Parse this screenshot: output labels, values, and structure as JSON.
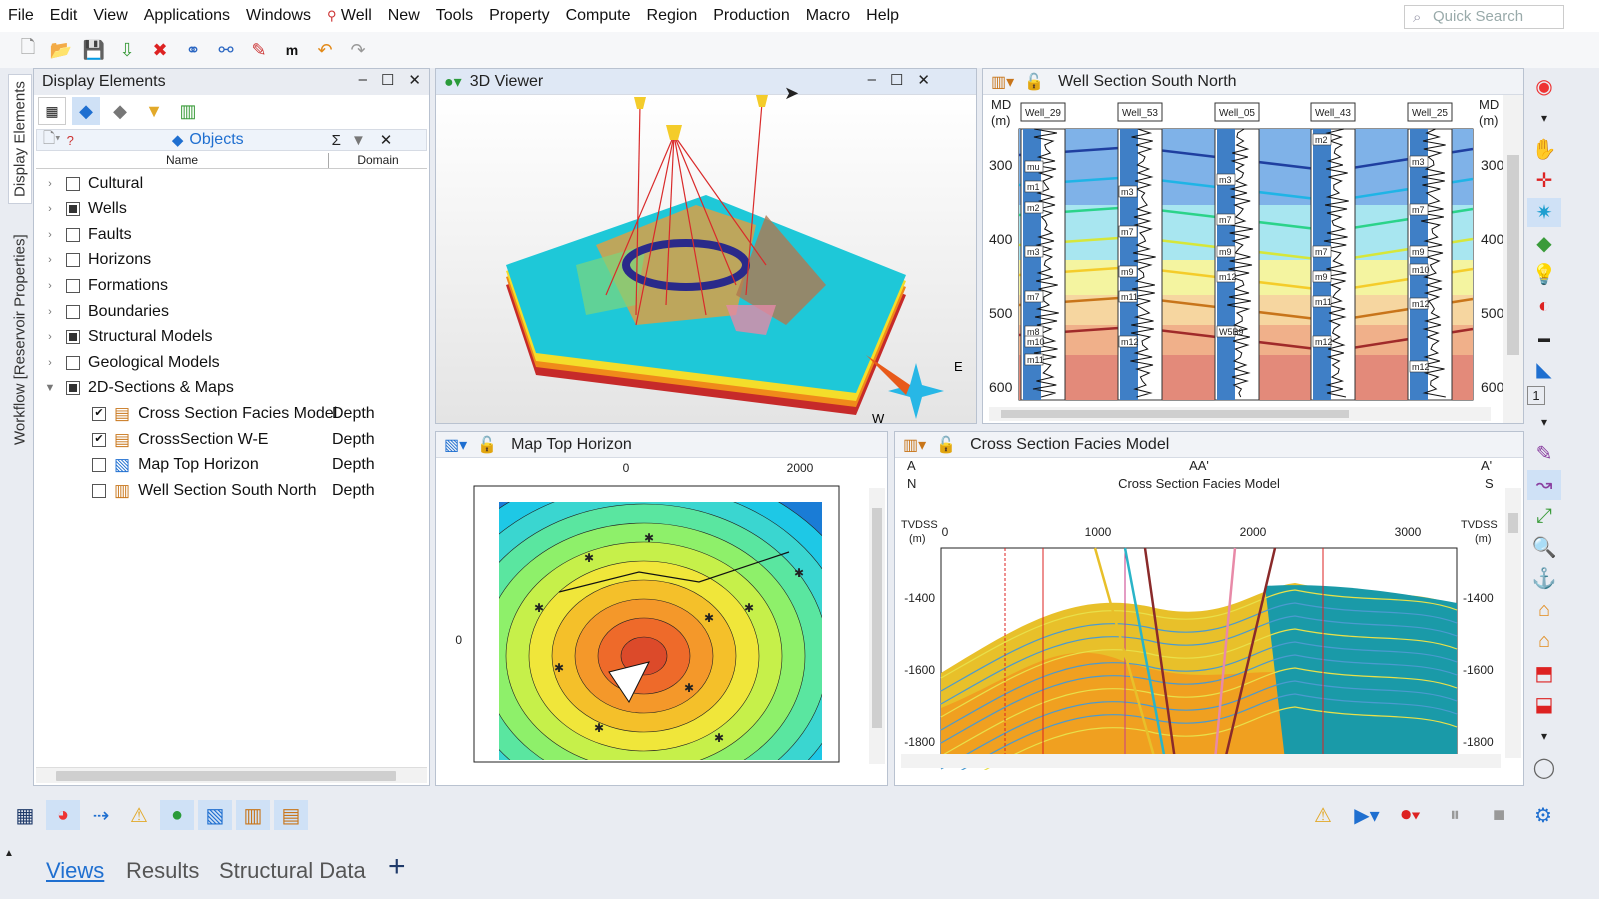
{
  "menu": {
    "items": [
      "File",
      "Edit",
      "View",
      "Applications",
      "Windows",
      "Well",
      "New",
      "Tools",
      "Property",
      "Compute",
      "Region",
      "Production",
      "Macro",
      "Help"
    ],
    "search_placeholder": "Quick Search"
  },
  "side_tabs": {
    "display": "Display Elements",
    "workflow": "Workflow [Reservoir Properties]"
  },
  "display_panel": {
    "title": "Display Elements",
    "objects_label": "Objects",
    "col_name": "Name",
    "col_domain": "Domain"
  },
  "tree": [
    {
      "label": "Cultural",
      "state": "unchecked",
      "level": 0,
      "expander": "collapsed"
    },
    {
      "label": "Wells",
      "state": "partial",
      "level": 0,
      "expander": "collapsed"
    },
    {
      "label": "Faults",
      "state": "unchecked",
      "level": 0,
      "expander": "collapsed"
    },
    {
      "label": "Horizons",
      "state": "unchecked",
      "level": 0,
      "expander": "collapsed"
    },
    {
      "label": "Formations",
      "state": "unchecked",
      "level": 0,
      "expander": "collapsed"
    },
    {
      "label": "Boundaries",
      "state": "unchecked",
      "level": 0,
      "expander": "collapsed"
    },
    {
      "label": "Structural Models",
      "state": "partial",
      "level": 0,
      "expander": "collapsed"
    },
    {
      "label": "Geological Models",
      "state": "unchecked",
      "level": 0,
      "expander": "collapsed"
    },
    {
      "label": "2D-Sections & Maps",
      "state": "partial",
      "level": 0,
      "expander": "expanded"
    },
    {
      "label": "Cross Section Facies Model",
      "domain": "Depth",
      "state": "checked",
      "level": 1,
      "icon": "section-icon"
    },
    {
      "label": "CrossSection W-E",
      "domain": "Depth",
      "state": "checked",
      "level": 1,
      "icon": "section-icon"
    },
    {
      "label": "Map Top Horizon",
      "domain": "Depth",
      "state": "unchecked",
      "level": 1,
      "icon": "map-icon"
    },
    {
      "label": "Well Section South North",
      "domain": "Depth",
      "state": "unchecked",
      "level": 1,
      "icon": "well-section-icon"
    }
  ],
  "viewer3d": {
    "title": "3D Viewer",
    "compass_e": "E",
    "compass_w": "W"
  },
  "well_section": {
    "title": "Well Section South North",
    "md_label": "MD",
    "unit": "(m)",
    "depths": [
      "300",
      "400",
      "500",
      "600"
    ],
    "wells": [
      "Well_29",
      "Well_53",
      "Well_05",
      "Well_43",
      "Well_25"
    ],
    "markers": [
      "mu",
      "m1",
      "m2",
      "m3",
      "m7",
      "m8",
      "m9",
      "m10",
      "m11",
      "m12",
      "W5B9"
    ]
  },
  "map": {
    "title": "Map Top Horizon",
    "x_ticks": [
      "0",
      "2000"
    ],
    "y_ticks": [
      "0"
    ]
  },
  "facies": {
    "title": "Cross Section Facies Model",
    "left_a": "A",
    "left_n": "N",
    "mid": "AA'",
    "subtitle": "Cross Section Facies Model",
    "right_a": "A'",
    "right_s": "S",
    "tvdss": "TVDSS",
    "unit": "(m)",
    "x_ticks": [
      "0",
      "1000",
      "2000",
      "3000"
    ],
    "y_ticks": [
      "-1400",
      "-1600",
      "-1800"
    ]
  },
  "bottom_tabs": [
    "Views",
    "Results",
    "Structural Data"
  ],
  "colors": {
    "accent": "#1f6fd0",
    "panel_border": "#b9c2d0"
  }
}
